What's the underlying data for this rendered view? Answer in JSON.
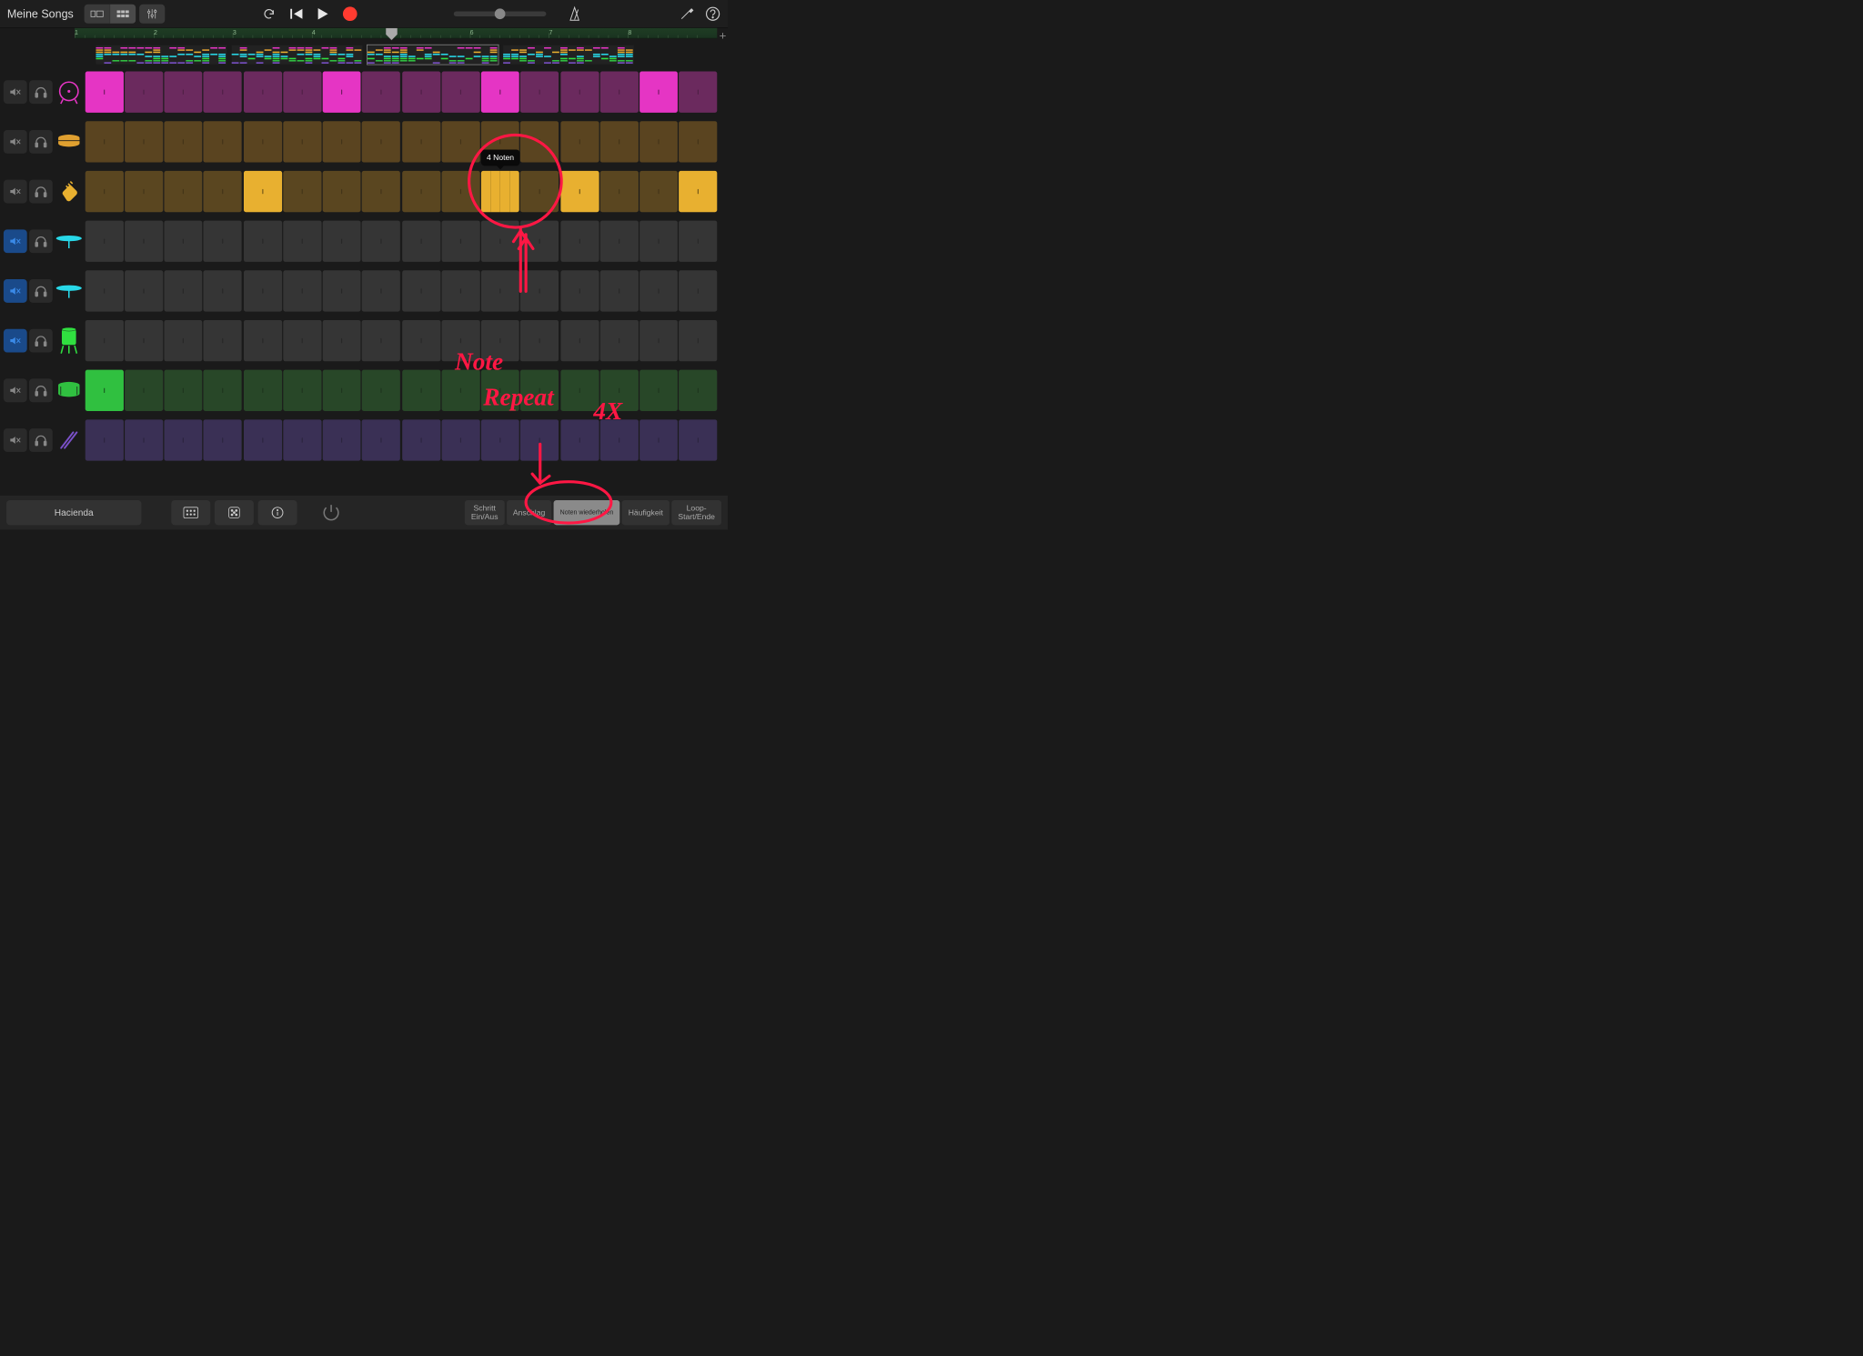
{
  "header": {
    "title": "Meine Songs"
  },
  "ruler": {
    "bars": [
      1,
      2,
      3,
      4,
      5,
      6,
      7,
      8
    ],
    "playhead_bar": 5
  },
  "tooltip": "4 Noten",
  "tracks": [
    {
      "id": "kick",
      "color": "#e535c4",
      "dim": "#6b2a5e",
      "muted": false,
      "icon": "kick",
      "steps": [
        1,
        0,
        0,
        0,
        0,
        0,
        1,
        0,
        0,
        0,
        1,
        0,
        0,
        0,
        1,
        0
      ]
    },
    {
      "id": "snare",
      "color": "#e0a030",
      "dim": "#5a4420",
      "muted": false,
      "icon": "snare",
      "steps": [
        0,
        0,
        0,
        0,
        0,
        0,
        0,
        0,
        0,
        0,
        0,
        0,
        0,
        0,
        0,
        0
      ]
    },
    {
      "id": "clap",
      "color": "#e8b030",
      "dim": "#5a4620",
      "muted": false,
      "icon": "clap",
      "steps": [
        0,
        0,
        0,
        0,
        1,
        0,
        0,
        0,
        0,
        0,
        "4",
        0,
        1,
        0,
        0,
        1
      ]
    },
    {
      "id": "hh1",
      "color": "#28d8e8",
      "dim": "#353535",
      "muted": true,
      "icon": "cymbal",
      "steps": [
        0,
        0,
        0,
        0,
        0,
        0,
        0,
        0,
        0,
        0,
        0,
        0,
        0,
        0,
        0,
        0
      ]
    },
    {
      "id": "hh2",
      "color": "#28d8e8",
      "dim": "#353535",
      "muted": true,
      "icon": "cymbal",
      "steps": [
        0,
        0,
        0,
        0,
        0,
        0,
        0,
        0,
        0,
        0,
        0,
        0,
        0,
        0,
        0,
        0
      ]
    },
    {
      "id": "tom",
      "color": "#30e040",
      "dim": "#353535",
      "muted": true,
      "icon": "tom",
      "steps": [
        0,
        0,
        0,
        0,
        0,
        0,
        0,
        0,
        0,
        0,
        0,
        0,
        0,
        0,
        0,
        0
      ]
    },
    {
      "id": "floor",
      "color": "#30c040",
      "dim": "#284728",
      "muted": false,
      "icon": "floor",
      "steps": [
        1,
        0,
        0,
        0,
        0,
        0,
        0,
        0,
        0,
        0,
        0,
        0,
        0,
        0,
        0,
        0
      ]
    },
    {
      "id": "stick",
      "color": "#7a50c8",
      "dim": "#3a3055",
      "muted": false,
      "icon": "stick",
      "steps": [
        0,
        0,
        0,
        0,
        0,
        0,
        0,
        0,
        0,
        0,
        0,
        0,
        0,
        0,
        0,
        0
      ]
    }
  ],
  "preset": "Hacienda",
  "tabs": [
    "Schritt Ein/Aus",
    "Anschlag",
    "Noten wiederholen",
    "Häufigkeit",
    "Loop-Start/Ende"
  ],
  "tab_selected": 2,
  "annotations": {
    "line1": "Note",
    "line2": "Repeat",
    "line3": "4X"
  }
}
